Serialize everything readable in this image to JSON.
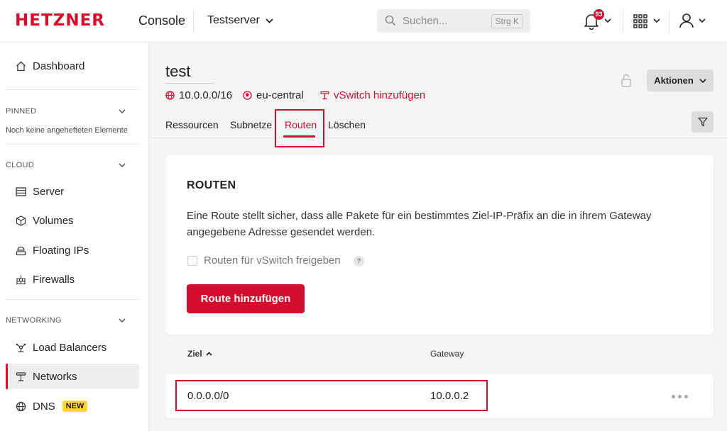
{
  "header": {
    "logo": "HETZNER",
    "product": "Console",
    "project": "Testserver",
    "search_placeholder": "Suchen...",
    "search_shortcut": "Strg K",
    "notification_count": "93"
  },
  "sidebar": {
    "dashboard": "Dashboard",
    "pinned": {
      "title": "PINNED",
      "empty_text": "Noch keine angehefteten Elemente"
    },
    "cloud": {
      "title": "CLOUD",
      "items": [
        "Server",
        "Volumes",
        "Floating IPs",
        "Firewalls"
      ]
    },
    "networking": {
      "title": "NETWORKING",
      "items": [
        "Load Balancers",
        "Networks",
        "DNS"
      ],
      "new_badge": "NEW"
    }
  },
  "network": {
    "name": "test",
    "ip_range": "10.0.0.0/16",
    "zone": "eu-central",
    "vswitch_link": "vSwitch hinzufügen",
    "actions_label": "Aktionen"
  },
  "tabs": [
    "Ressourcen",
    "Subnetze",
    "Routen",
    "Löschen"
  ],
  "routes_card": {
    "title": "ROUTEN",
    "description": "Eine Route stellt sicher, dass alle Pakete für ein bestimmtes Ziel-IP-Präfix an die in ihrem Gateway angegebene Adresse gesendet werden.",
    "checkbox_label": "Routen für vSwitch freigeben",
    "help": "?",
    "add_button": "Route hinzufügen"
  },
  "table": {
    "columns": [
      "Ziel",
      "Gateway"
    ],
    "rows": [
      {
        "destination": "0.0.0.0/0",
        "gateway": "10.0.0.2"
      }
    ]
  },
  "colors": {
    "brand": "#d50c2d",
    "badge_new": "#ffd43b"
  }
}
